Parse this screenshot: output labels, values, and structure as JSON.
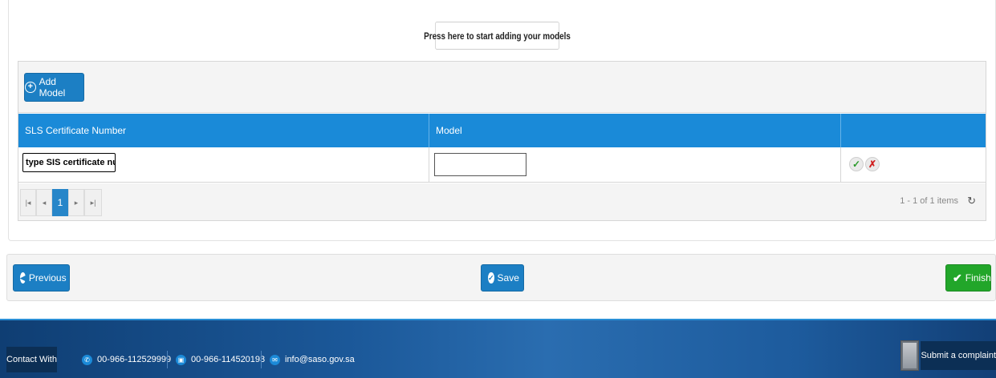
{
  "top": {
    "start_label": "Press here to start adding your models"
  },
  "grid": {
    "add_label": "Add Model",
    "columns": [
      "SLS Certificate Number",
      "Model",
      ""
    ],
    "row": {
      "sls_value": "type SIS certificate number",
      "model_value": ""
    },
    "pager": {
      "current_page": "1",
      "info": "1 - 1 of 1 items"
    }
  },
  "actions": {
    "previous_label": "Previous",
    "save_label": "Save",
    "finish_label": "Finish"
  },
  "footer": {
    "contact_label": "Contact With",
    "phone": "00-966-112529999",
    "fax": "00-966-114520193",
    "email": "info@saso.gov.sa",
    "complaint_label": "Submit a complaint"
  },
  "colors": {
    "primary": "#1c7fc4",
    "header": "#1a8ad8",
    "success": "#22a62a",
    "footer": "#1b5899"
  },
  "icons": [
    "plus-circle-icon",
    "check-icon",
    "close-icon",
    "first-page-icon",
    "prev-page-icon",
    "next-page-icon",
    "last-page-icon",
    "refresh-icon",
    "arrow-left-circle-icon",
    "check-circle-icon",
    "phone-icon",
    "fax-icon",
    "mail-icon",
    "document-icon"
  ]
}
